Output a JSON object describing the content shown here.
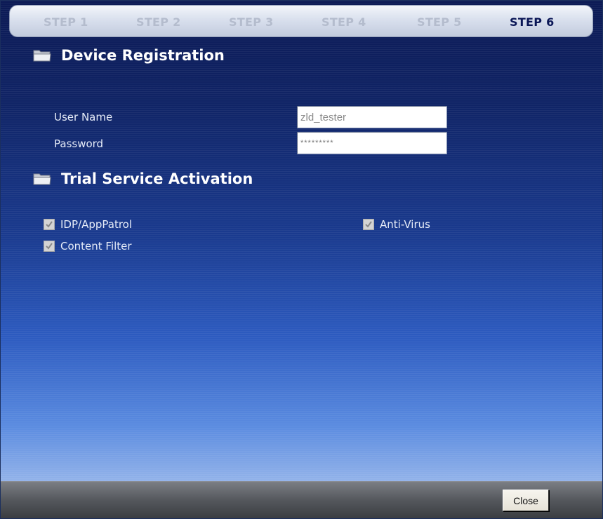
{
  "steps": [
    "STEP 1",
    "STEP 2",
    "STEP 3",
    "STEP 4",
    "STEP 5",
    "STEP 6"
  ],
  "active_step": "STEP 6",
  "device_registration": {
    "title": "Device Registration",
    "username_label": "User Name",
    "username_value": "zld_tester",
    "password_label": "Password",
    "password_value": "*********"
  },
  "trial_service": {
    "title": "Trial Service Activation",
    "options": [
      {
        "label": "IDP/AppPatrol",
        "checked": true
      },
      {
        "label": "Anti-Virus",
        "checked": true
      },
      {
        "label": "Content Filter",
        "checked": true
      }
    ]
  },
  "footer": {
    "close_label": "Close"
  },
  "icons": {
    "section": "folder-icon",
    "checkbox": "checkmark-icon"
  },
  "colors": {
    "background_top": "#0c1a55",
    "background_bottom": "#b8cdf0",
    "active_step": "#0a1656",
    "inactive_step": "#b4bccd"
  }
}
